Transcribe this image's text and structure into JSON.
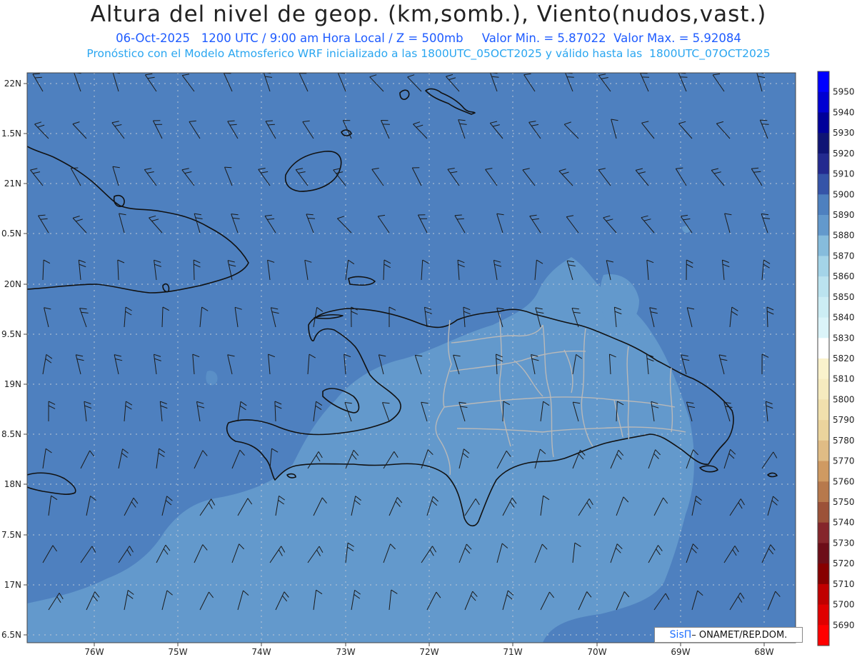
{
  "title": "Altura del nivel de geop. (km,somb.), Viento(nudos,vast.)",
  "subtitle_line1": "06-Oct-2025   1200 UTC / 9:00 am Hora Local / Z = 500mb     Valor Min. = 5.87022  Valor Max. = 5.92084",
  "subtitle_line2": "Pronóstico con el Modelo Atmosferico WRF inicializado a las 1800UTC_05OCT2025 y válido hasta las  1800UTC_07OCT2025",
  "credit": {
    "brand": "SisΠ",
    "text": "– ONAMET/REP.DOM."
  },
  "axes": {
    "lat_ticks": [
      "22N",
      "1.5N",
      "21N",
      "0.5N",
      "20N",
      "9.5N",
      "19N",
      "8.5N",
      "18N",
      "7.5N",
      "17N",
      "6.5N"
    ],
    "lon_ticks": [
      "76W",
      "75W",
      "74W",
      "73W",
      "72W",
      "71W",
      "70W",
      "69W",
      "68W"
    ]
  },
  "colorbar": {
    "levels": [
      {
        "label": "5950",
        "color": "#0000ff"
      },
      {
        "label": "5940",
        "color": "#0000d2"
      },
      {
        "label": "5930",
        "color": "#00009a"
      },
      {
        "label": "5920",
        "color": "#0f1475"
      },
      {
        "label": "5910",
        "color": "#232a8f"
      },
      {
        "label": "5900",
        "color": "#3554a8"
      },
      {
        "label": "5890",
        "color": "#4e80bf"
      },
      {
        "label": "5880",
        "color": "#6399cc"
      },
      {
        "label": "5870",
        "color": "#86bcdc"
      },
      {
        "label": "5860",
        "color": "#a4d4e8"
      },
      {
        "label": "5850",
        "color": "#bbe3ef"
      },
      {
        "label": "5840",
        "color": "#ccedf4"
      },
      {
        "label": "5830",
        "color": "#dbf4f9"
      },
      {
        "label": "5820",
        "color": "#ffffff"
      },
      {
        "label": "5810",
        "color": "#faf2cc"
      },
      {
        "label": "5800",
        "color": "#f6ebbf"
      },
      {
        "label": "5790",
        "color": "#f1e0ad"
      },
      {
        "label": "5780",
        "color": "#ebd49d"
      },
      {
        "label": "5770",
        "color": "#e0bc85"
      },
      {
        "label": "5760",
        "color": "#cf9a62"
      },
      {
        "label": "5750",
        "color": "#b7794c"
      },
      {
        "label": "5740",
        "color": "#9c5238"
      },
      {
        "label": "5730",
        "color": "#85262b"
      },
      {
        "label": "5720",
        "color": "#6d0e18"
      },
      {
        "label": "5710",
        "color": "#870000"
      },
      {
        "label": "5700",
        "color": "#c00000"
      },
      {
        "label": "5690",
        "color": "#e00000"
      }
    ],
    "bottom_color": "#ff0000"
  },
  "colors": {
    "background_field": "#4e80bf",
    "lower_field": "#6399cc",
    "coast": "#111111",
    "borders": "#b9b9b9",
    "grid": "#bcc8d6"
  }
}
